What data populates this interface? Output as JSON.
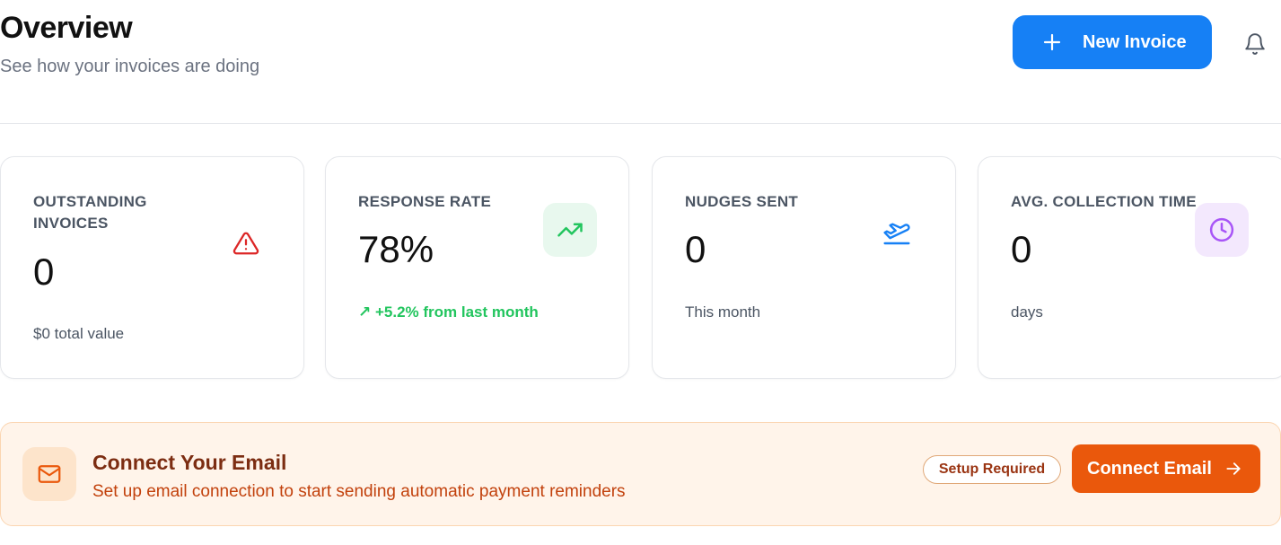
{
  "header": {
    "title": "Overview",
    "subtitle": "See how your invoices are doing",
    "new_invoice_label": "New Invoice"
  },
  "cards": [
    {
      "title_line1": "OUTSTANDING",
      "title_line2": "INVOICES",
      "value": "0",
      "sub": "$0 total value",
      "icon": "alert-triangle-icon",
      "icon_color": "#dc2626"
    },
    {
      "title": "RESPONSE RATE",
      "value": "78%",
      "sub": "↗ +5.2% from last month",
      "icon": "trending-up-icon",
      "icon_color": "#22c55e"
    },
    {
      "title": "NUDGES SENT",
      "value": "0",
      "sub": "This month",
      "icon": "plane-departure-icon",
      "icon_color": "#1680f5"
    },
    {
      "title": "AVG. COLLECTION TIME",
      "value": "0",
      "sub": "days",
      "icon": "clock-icon",
      "icon_color": "#a855f7"
    }
  ],
  "banner": {
    "title": "Connect Your Email",
    "text": "Set up email connection to start sending automatic payment reminders",
    "badge": "Setup Required",
    "button_label": "Connect Email",
    "icon": "mail-icon"
  },
  "colors": {
    "primary": "#1680f5",
    "orange": "#ea580c",
    "green": "#22c55e",
    "red": "#dc2626",
    "purple": "#a855f7"
  }
}
